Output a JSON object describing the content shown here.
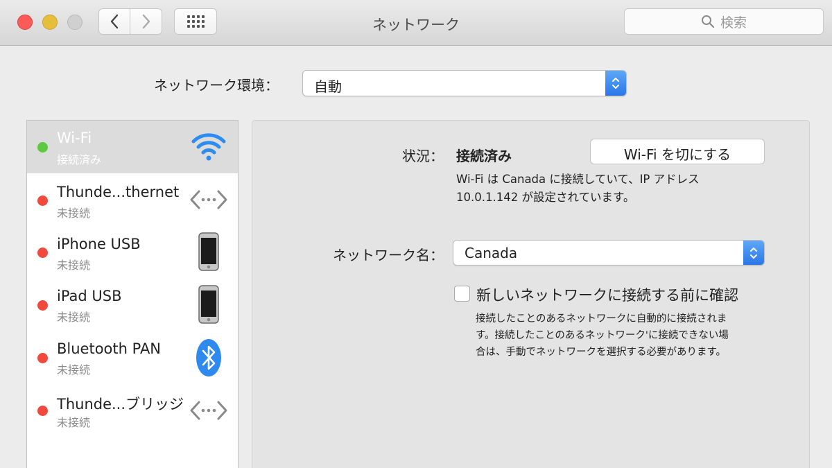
{
  "window": {
    "title": "ネットワーク",
    "search_placeholder": "検索",
    "nav_back_label": "‹",
    "nav_forward_label": "›"
  },
  "location": {
    "label": "ネットワーク環境：",
    "value": "自動"
  },
  "services": [
    {
      "name": "Wi-Fi",
      "status": "接続済み",
      "state_color": "#5cc940",
      "icon": "wifi-icon"
    },
    {
      "name": "Thunde...thernet",
      "status": "未接続",
      "state_color": "#f0493e",
      "icon": "ethernet-arrows-icon"
    },
    {
      "name": "iPhone USB",
      "status": "未接続",
      "state_color": "#f0493e",
      "icon": "iphone-icon"
    },
    {
      "name": "iPad USB",
      "status": "未接続",
      "state_color": "#f0493e",
      "icon": "ipad-icon"
    },
    {
      "name": "Bluetooth PAN",
      "status": "未接続",
      "state_color": "#f0493e",
      "icon": "bluetooth-icon"
    },
    {
      "name": "Thunde...ブリッジ",
      "status": "未接続",
      "state_color": "#f0493e",
      "icon": "bridge-arrows-icon"
    }
  ],
  "detail": {
    "status_label": "状況：",
    "status_value": "接続済み",
    "toggle_button": "Wi-Fi を切にする",
    "status_desc_line1": "Wi-Fi は Canada に接続していて、IP アドレス",
    "status_desc_line2": "10.0.1.142 が設定されています。",
    "network_name_label": "ネットワーク名：",
    "network_name_value": "Canada",
    "ask_checkbox_label": "新しいネットワークに接続する前に確認",
    "ask_checkbox_checked": false,
    "help_line1": "接続したことのあるネットワークに自動的に接続されま",
    "help_line2": "す。接続したことのあるネットワーク'に接続できない場",
    "help_line3": "合は、手動でネットワークを選択する必要があります。"
  },
  "colors": {
    "accent": "#2a76e8",
    "wifi_blue": "#2c8cf0",
    "connected": "#5cc940",
    "disconnected": "#f0493e"
  }
}
